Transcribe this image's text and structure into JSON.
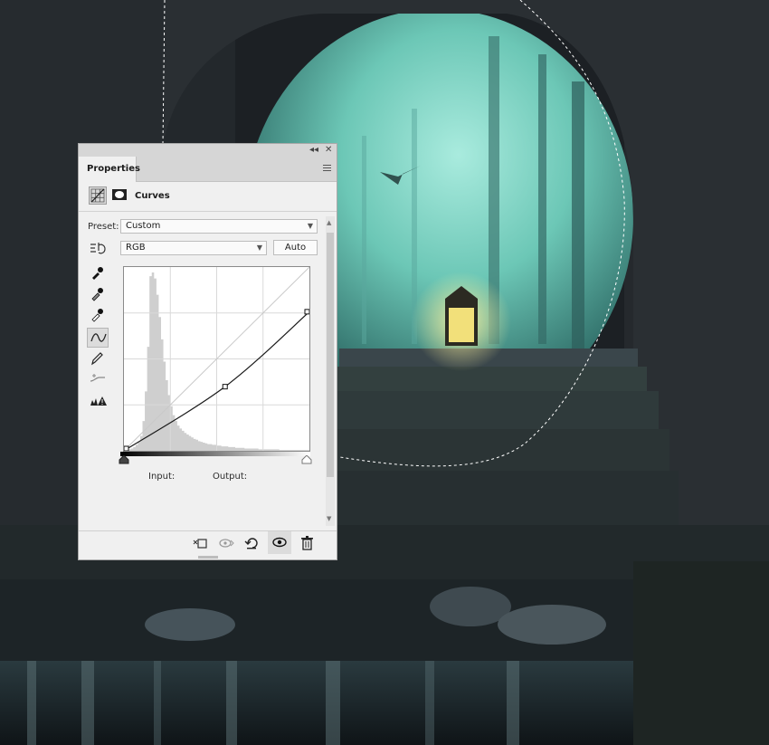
{
  "panel": {
    "tab_label": "Properties",
    "collapse_glyph": "◂◂",
    "close_glyph": "✕",
    "adjustment_title": "Curves",
    "preset_label": "Preset:",
    "preset_value": "Custom",
    "channel_value": "RGB",
    "auto_label": "Auto",
    "input_label": "Input:",
    "output_label": "Output:"
  },
  "tools": [
    "sample-shadows-eyedropper-icon",
    "sample-midtones-eyedropper-icon",
    "sample-highlights-eyedropper-icon",
    "curve-points-icon",
    "pencil-icon",
    "smooth-curve-icon",
    "clipping-warning-icon"
  ],
  "footer_icons": [
    "clip-to-layer-icon",
    "view-previous-icon",
    "reset-icon",
    "visibility-eye-icon",
    "trash-icon"
  ],
  "colors": {
    "fog_teal": "#7fd8c8",
    "lantern_glow": "#f2e07a",
    "panel_bg": "#f0f0f0"
  },
  "chart_data": {
    "type": "line",
    "title": "",
    "xlabel": "",
    "ylabel": "",
    "xlim": [
      0,
      255
    ],
    "ylim": [
      0,
      255
    ],
    "grid": true,
    "series": [
      {
        "values_x": [
          0,
          139,
          255
        ],
        "values_y": [
          0,
          89,
          193
        ]
      }
    ],
    "control_points": [
      [
        0,
        0
      ],
      [
        139,
        89
      ],
      [
        255,
        193
      ]
    ],
    "histogram": [
      0,
      1,
      2,
      3,
      5,
      8,
      12,
      20,
      40,
      80,
      140,
      235,
      240,
      232,
      210,
      180,
      150,
      120,
      95,
      75,
      60,
      48,
      40,
      34,
      30,
      27,
      24,
      22,
      20,
      18,
      16,
      15,
      13,
      12,
      11,
      10,
      9,
      9,
      8,
      8,
      7,
      7,
      6,
      6,
      6,
      5,
      5,
      5,
      4,
      4,
      4,
      4,
      3,
      3,
      3,
      3,
      3,
      3,
      2,
      2,
      2,
      2,
      2,
      2,
      2,
      2,
      2,
      1,
      1,
      1,
      1,
      1,
      1,
      1,
      1,
      1,
      1,
      1,
      1,
      1
    ]
  }
}
